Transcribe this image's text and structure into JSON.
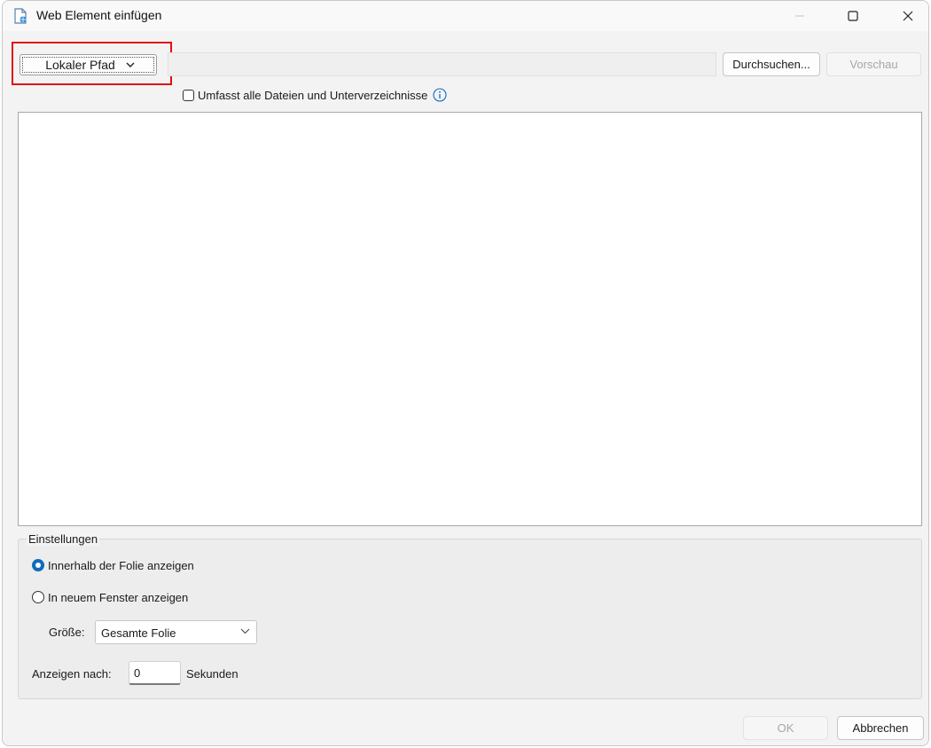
{
  "window": {
    "title": "Web Element einfügen"
  },
  "source": {
    "selected": "Lokaler Pfad",
    "path_value": "",
    "browse_label": "Durchsuchen...",
    "preview_label": "Vorschau",
    "include_subdirs_label": "Umfasst alle Dateien und Unterverzeichnisse",
    "include_subdirs_checked": false
  },
  "settings": {
    "legend": "Einstellungen",
    "radio_inside_label": "Innerhalb der Folie anzeigen",
    "radio_inside_checked": true,
    "radio_new_window_label": "In neuem Fenster anzeigen",
    "radio_new_window_checked": false,
    "size_label": "Größe:",
    "size_value": "Gesamte Folie",
    "delay_label": "Anzeigen nach:",
    "delay_value": "0",
    "delay_unit": "Sekunden"
  },
  "footer": {
    "ok_label": "OK",
    "cancel_label": "Abbrechen"
  },
  "colors": {
    "accent": "#0f6cbd",
    "highlight": "#e01010",
    "disabled_text": "#a6a6a6"
  }
}
